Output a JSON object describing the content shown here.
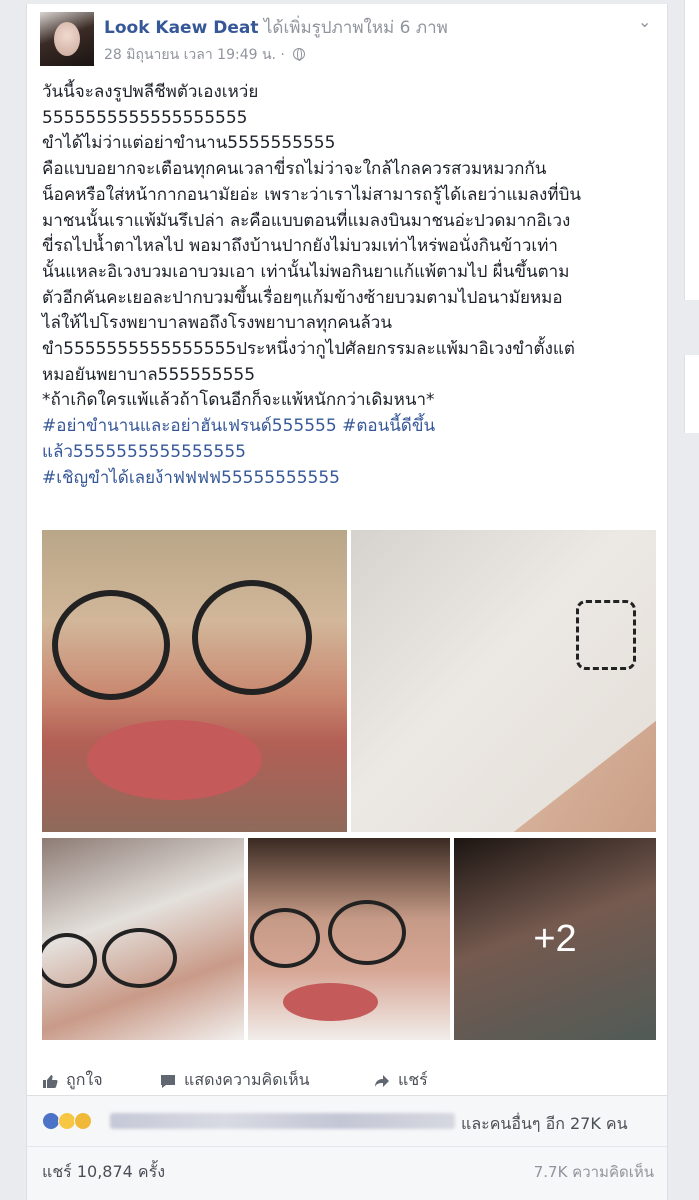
{
  "post": {
    "author": "Look Kaew Deat",
    "action": " ได้เพิ่มรูปภาพใหม่ 6 ภาพ",
    "timestamp": "28 มิถุนายน เวลา 19:49 น.",
    "separator": " · ",
    "privacy_icon": "globe-icon",
    "text_lines": [
      "วันนี้จะลงรูปพลีชีพตัวเองเหว่ย",
      "5555555555555555555",
      "ขำได้ไม่ว่าแต่อย่าขำนาน5555555555",
      "คือแบบอยากจะเตือนทุกคนเวลาขี่รถไม่ว่าจะใกล้ไกลควรสวมหมวกกัน",
      "น็อคหรือใส่หน้ากากอนามัยอ่ะ เพราะว่าเราไม่สามารถรู้ได้เลยว่าแมลงที่บิน",
      "มาชนนั้นเราแพ้มันรึเปล่า ละคือแบบตอนที่แมลงบินมาชนอ่ะปวดมากอิเวง",
      "ขี่รถไปน้ำตาไหลไป พอมาถึงบ้านปากยังไม่บวมเท่าไหร่พอนั่งกินข้าวเท่า",
      "นั้นแหละอิเวงบวมเอาบวมเอา เท่านั้นไม่พอกินยาแก้แพ้ตามไป ผื่นขึ้นตาม",
      "ตัวอีกคันคะเยอละปากบวมขึ้นเรื่อยๆแก้มข้างซ้ายบวมตามไปอนามัยหมอ",
      "ไล่ให้ไปโรงพยาบาลพอถึงโรงพยาบาลทุกคนล้วน",
      "ขำ5555555555555555ประหนึ่งว่ากูไปศัลยกรรมละแพ้มาอิเวงขำตั้งแต่",
      "หมอยันพยาบาล555555555",
      "*ถ้าเกิดใครแพ้แล้วถ้าโดนอีกก็จะแพ้หนักกว่าเดิมหนา*"
    ],
    "hashtag_lines": [
      "#อย่าขำนานและอย่าฮันเฟรนด์555555 #ตอนนี้ดีขึ้น",
      "แล้ว5555555555555555",
      "#เชิญขำได้เลยง้าฟฟฟฟ55555555555"
    ],
    "photos_more": "+2"
  },
  "actions": {
    "like": "ถูกใจ",
    "comment": "แสดงความคิดเห็น",
    "share": "แชร์"
  },
  "stats": {
    "reaction_icons": [
      "like-icon",
      "haha-icon",
      "sad-icon"
    ],
    "others": "และคนอื่นๆ อีก 27K คน",
    "shares": "แชร์ 10,874 ครั้ง",
    "comments": "7.7K ความคิดเห็น"
  },
  "colors": {
    "link": "#365899",
    "muted": "#90949c",
    "like_blue": "#4c73c7"
  }
}
